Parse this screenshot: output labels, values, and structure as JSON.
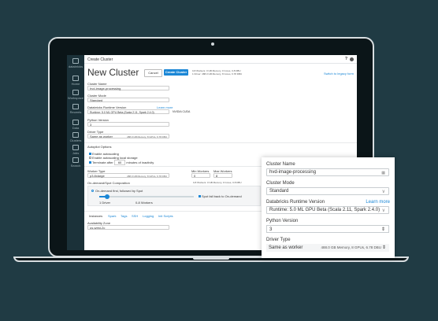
{
  "sidebar": {
    "items": [
      {
        "label": "databricks",
        "icon": "databricks-logo-icon"
      },
      {
        "label": "Home",
        "icon": "home-icon"
      },
      {
        "label": "Workspace",
        "icon": "workspace-icon"
      },
      {
        "label": "Recents",
        "icon": "clock-icon"
      },
      {
        "label": "Data",
        "icon": "data-icon"
      },
      {
        "label": "Clusters",
        "icon": "cluster-icon"
      },
      {
        "label": "Jobs",
        "icon": "jobs-icon"
      },
      {
        "label": "Search",
        "icon": "search-icon"
      }
    ]
  },
  "header": {
    "breadcrumb": "Create Cluster",
    "help": "?"
  },
  "page": {
    "title": "New Cluster",
    "cancel_label": "Cancel",
    "create_label": "Create Cluster",
    "summary_line1": "0-8 Workers: 0 GB Memory, 0 Cores, 0-8 DBU",
    "summary_line2": "1 Driver: 488.0 GB Memory, 8 Cores, 6.78 DBU",
    "legacy_link": "Switch to legacy form"
  },
  "form": {
    "cluster_name_label": "Cluster Name",
    "cluster_name_value": "hvd-image-processing",
    "cluster_mode_label": "Cluster Mode",
    "cluster_mode_value": "Standard",
    "runtime_label": "Databricks Runtime Version",
    "runtime_learn_more": "Learn more",
    "runtime_value": "Runtime: 5.0 ML GPU Beta (Scala 2.11, Spark 2.4.0)",
    "runtime_note": "NVIDIA CUDA",
    "python_label": "Python Version",
    "python_value": "3",
    "driver_type_label": "Driver Type",
    "driver_type_value": "Same as worker",
    "driver_type_desc": "488.0 GB Memory, 8 GPUs, 6.78 DBU",
    "autopilot_label": "Autopilot Options",
    "autoscaling_label": "Enable autoscaling",
    "autoscaling_disk_label": "Enable autoscaling local storage",
    "terminate_label": "Terminate after",
    "terminate_value": "60",
    "terminate_suffix": "minutes of inactivity",
    "worker_type_label": "Worker Type",
    "worker_type_value": "p3.8xlarge",
    "worker_type_desc": "488.0 GB Memory, 8 GPUs, 6.78 DBU",
    "min_workers_label": "Min Workers",
    "min_workers_value": "0",
    "max_workers_label": "Max Workers",
    "max_workers_value": "8",
    "ondemand_label": "On-demand/Spot Composition",
    "ondemand_option": "On-demand first, followed by Spot",
    "spot_fallback": "Spot fall back to On-demand",
    "slider_left": "1 Driver",
    "slider_right": "0-8 Workers",
    "tabs": [
      "Instances",
      "Spark",
      "Tags",
      "SSH",
      "Logging",
      "Init Scripts"
    ],
    "availability_label": "Availability Zone",
    "availability_value": "us-west-2c"
  },
  "zoom": {
    "cluster_name_label": "Cluster Name",
    "cluster_name_value": "hvd-image-processing",
    "cluster_mode_label": "Cluster Mode",
    "cluster_mode_value": "Standard",
    "runtime_label": "Databricks Runtime Version",
    "learn_more": "Learn more",
    "runtime_value": "Runtime: 5.0 ML GPU Beta (Scala 2.11, Spark 2.4.0)",
    "python_label": "Python Version",
    "python_value": "3",
    "driver_type_label": "Driver Type",
    "driver_type_value": "Same as worker",
    "driver_type_desc": "488.0 GB Memory, 8 GPUs, 6.78 DBU"
  },
  "colors": {
    "accent": "#1b87d6",
    "background": "#203b44",
    "sidebar": "#1b3139"
  }
}
